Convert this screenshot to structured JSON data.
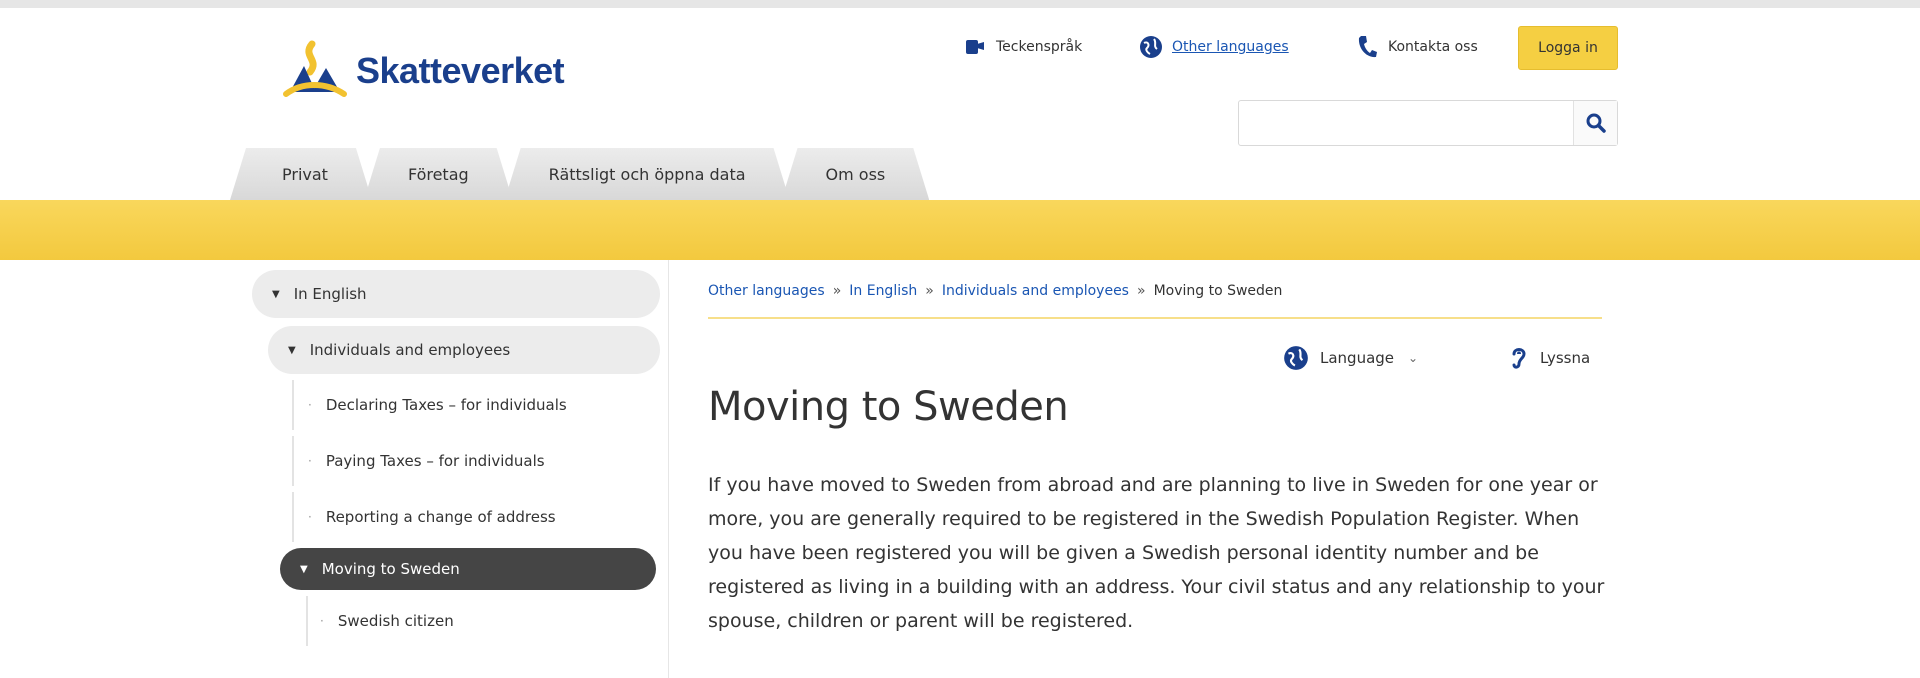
{
  "header": {
    "brand": "Skatteverket",
    "utility": {
      "tecken": "Teckenspråk",
      "languages": "Other languages",
      "kontakt": "Kontakta oss"
    },
    "login_label": "Logga in",
    "search": {
      "value": "",
      "placeholder": ""
    }
  },
  "nav": {
    "tabs": [
      "Privat",
      "Företag",
      "Rättsligt och öppna data",
      "Om oss"
    ]
  },
  "sidebar": {
    "items": [
      "In English",
      "Individuals and employees",
      "Declaring Taxes – for individuals",
      "Paying Taxes – for individuals",
      "Reporting a change of address",
      "Moving to Sweden",
      "Swedish citizen"
    ]
  },
  "breadcrumb": {
    "items": [
      "Other languages",
      "In English",
      "Individuals and employees"
    ],
    "current": "Moving to Sweden"
  },
  "tools": {
    "language": "Language",
    "listen": "Lyssna"
  },
  "main": {
    "title": "Moving to Sweden",
    "paragraph": "If you have moved to Sweden from abroad and are planning to live in Sweden for one year or more, you are generally required to be registered in the Swedish Population Register. When you have been registered you will be given a Swedish personal identity number and be registered as living in a building with an address. Your civil status and any relationship to your spouse, children or parent will be registered."
  },
  "colors": {
    "brand_blue": "#1a3f8c",
    "accent_yellow": "#f5cf42",
    "link_blue": "#1a56b3",
    "active_item": "#454545"
  },
  "icons": {
    "tecken": "sign-language-icon",
    "languages": "globe-icon",
    "kontakt": "phone-icon",
    "search": "search-icon",
    "language_tool": "globe-icon",
    "listen": "listen-icon"
  }
}
